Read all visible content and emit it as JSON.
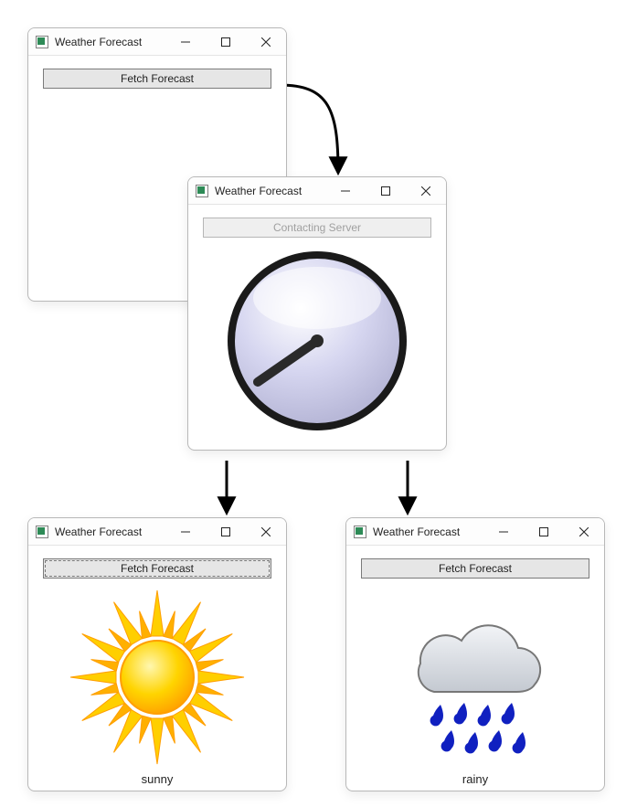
{
  "windows": {
    "initial": {
      "title": "Weather Forecast",
      "button_label": "Fetch Forecast"
    },
    "loading": {
      "title": "Weather Forecast",
      "button_label": "Contacting Server"
    },
    "sunny": {
      "title": "Weather Forecast",
      "button_label": "Fetch Forecast",
      "result_label": "sunny"
    },
    "rainy": {
      "title": "Weather Forecast",
      "button_label": "Fetch Forecast",
      "result_label": "rainy"
    }
  },
  "icons": {
    "app": "app-icon",
    "minimize": "minimize-icon",
    "maximize": "maximize-icon",
    "close": "close-icon",
    "clock": "clock-icon",
    "sun": "sun-icon",
    "rain": "rain-cloud-icon"
  },
  "colors": {
    "window_border": "#b8b8b8",
    "button_bg": "#e6e6e6",
    "button_border": "#7a7a7a",
    "disabled_text": "#a0a0a0",
    "sun_fill": "#ffd400",
    "sun_core": "#ffb000",
    "cloud_fill": "#d9dde2",
    "rain_drop": "#1020c0",
    "clock_face": "#d6d6f0",
    "arrow": "#000000"
  },
  "diagram": {
    "flow": [
      {
        "from": "initial",
        "to": "loading",
        "trigger": "Fetch Forecast"
      },
      {
        "from": "loading",
        "to": "sunny"
      },
      {
        "from": "loading",
        "to": "rainy"
      }
    ]
  }
}
